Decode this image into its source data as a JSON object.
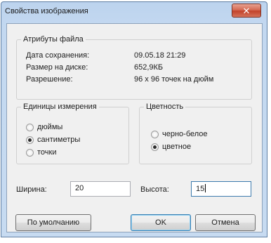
{
  "window": {
    "title": "Свойства изображения"
  },
  "file_attributes": {
    "legend": "Атрибуты файла",
    "rows": [
      {
        "label": "Дата сохранения:",
        "value": "09.05.18 21:29"
      },
      {
        "label": "Размер на диске:",
        "value": "652,9КБ"
      },
      {
        "label": "Разрешение:",
        "value": "96 x 96 точек на дюйм"
      }
    ]
  },
  "units": {
    "legend": "Единицы измерения",
    "options": [
      "дюймы",
      "сантиметры",
      "точки"
    ],
    "selected": "сантиметры"
  },
  "color": {
    "legend": "Цветность",
    "options": [
      "черно-белое",
      "цветное"
    ],
    "selected": "цветное"
  },
  "size": {
    "width_label": "Ширина:",
    "width_value": "20",
    "height_label": "Высота:",
    "height_value": "15"
  },
  "buttons": {
    "default": "По умолчанию",
    "ok": "OK",
    "cancel": "Отмена"
  }
}
